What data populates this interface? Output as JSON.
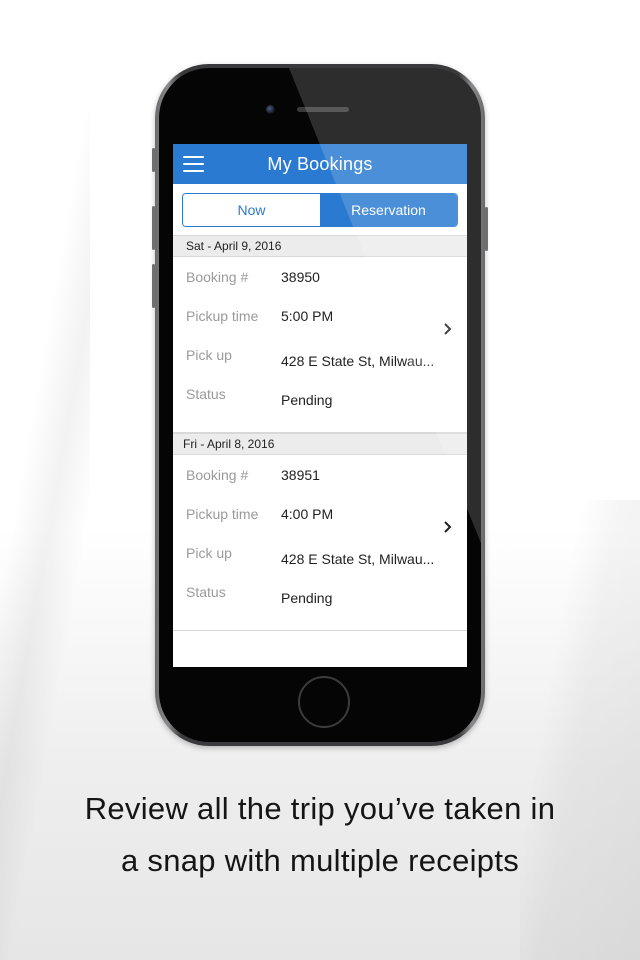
{
  "app": {
    "title": "My Bookings",
    "menu_icon": "hamburger-menu-icon"
  },
  "tabs": [
    {
      "label": "Now",
      "selected": false
    },
    {
      "label": "Reservation",
      "selected": true
    }
  ],
  "bookings": [
    {
      "date_header": "Sat -  April 9, 2016",
      "booking_label": "Booking #",
      "booking_number": "38950",
      "pickup_time_label": "Pickup time",
      "pickup_time": "5:00 PM",
      "pickup_label": "Pick up",
      "pickup_address": "428 E State St, Milwau...",
      "status_label": "Status",
      "status": "Pending"
    },
    {
      "date_header": "Fri -  April 8, 2016",
      "booking_label": "Booking #",
      "booking_number": "38951",
      "pickup_time_label": "Pickup time",
      "pickup_time": "4:00 PM",
      "pickup_label": "Pick up",
      "pickup_address": "428 E State St, Milwau...",
      "status_label": "Status",
      "status": "Pending"
    }
  ],
  "caption": {
    "line1": "Review all the trip you’ve taken in",
    "line2": "a snap with multiple receipts"
  },
  "colors": {
    "accent": "#2a7ad2",
    "section_header_bg": "#ececec",
    "label_gray": "#9a9a9a"
  }
}
